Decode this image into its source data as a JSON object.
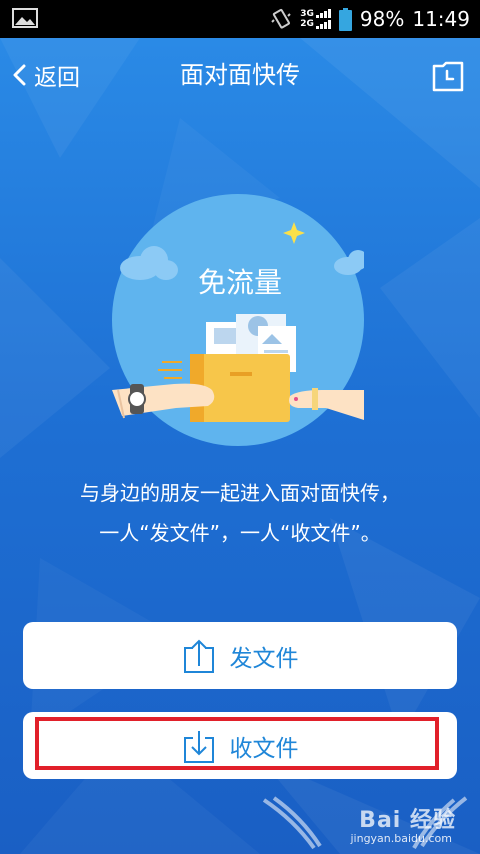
{
  "status_bar": {
    "network_top": "3G",
    "network_bottom": "2G",
    "battery_percent": "98%",
    "time": "11:49",
    "battery_level": 0.98,
    "icons": [
      "gallery-icon",
      "vibrate-icon",
      "signal-icon",
      "battery-icon"
    ]
  },
  "nav": {
    "back_label": "返回",
    "title": "面对面快传",
    "history_icon": "history-icon"
  },
  "hero": {
    "badge_text": "免流量",
    "icon": "file-handoff-illustration"
  },
  "description": {
    "line1": "与身边的朋友一起进入面对面快传，",
    "line2": "一人“发文件”，一人“收文件”。"
  },
  "actions": {
    "send_label": "发文件",
    "send_icon": "upload-icon",
    "receive_label": "收文件",
    "receive_icon": "download-icon"
  },
  "watermark": {
    "brand": "Bai 经验",
    "url": "jingyan.baidu.com"
  },
  "colors": {
    "background": "#1f6fd0",
    "button_text": "#1f86d8",
    "highlight": "#e1202a",
    "hero_circle": "#5fb4ee",
    "folder": "#f7c64a"
  }
}
